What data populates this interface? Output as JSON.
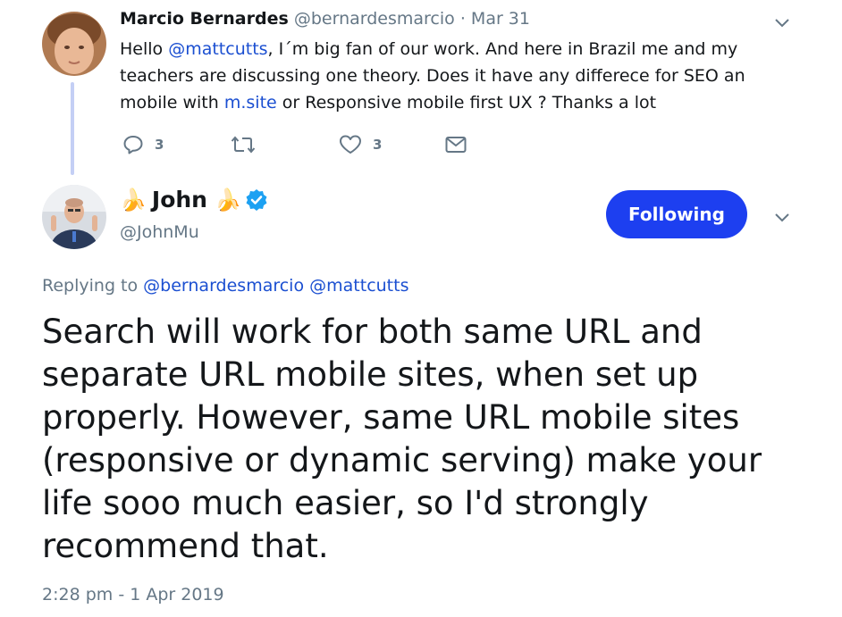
{
  "reply_tweet": {
    "author_name": "Marcio Bernardes",
    "handle": "@bernardesmarcio",
    "separator": "·",
    "date": "Mar 31",
    "text_parts": {
      "p1": "Hello ",
      "mention": "@mattcutts",
      "p2": ", I´m big fan of our work. And here in Brazil me and my teachers are discussing one theory. Does it have any differece for SEO an mobile with ",
      "link": "m.site",
      "p3": " or Responsive mobile first UX ? Thanks a lot"
    },
    "actions": {
      "reply_count": "3",
      "retweet_count": "",
      "like_count": "3"
    }
  },
  "main_tweet": {
    "author_name": "John",
    "author_emoji": "🍌",
    "handle": "@JohnMu",
    "follow_button": "Following",
    "replying_label": "Replying to ",
    "replying_to": [
      "@bernardesmarcio",
      "@mattcutts"
    ],
    "text": "Search will work for both same URL and separate URL mobile sites, when set up properly. However, same URL mobile sites (responsive or dynamic serving) make your life sooo much easier, so I'd strongly recommend that.",
    "timestamp": "2:28 pm - 1 Apr 2019"
  },
  "colors": {
    "link": "#1b4fd1",
    "secondary_text": "#657786",
    "follow_button_bg": "#1d3ff0",
    "verified_badge": "#1da1f2",
    "thread_line": "#c4cff5"
  },
  "icons": [
    "reply-icon",
    "retweet-icon",
    "like-icon",
    "dm-icon",
    "chevron-down-icon",
    "verified-badge-icon"
  ]
}
